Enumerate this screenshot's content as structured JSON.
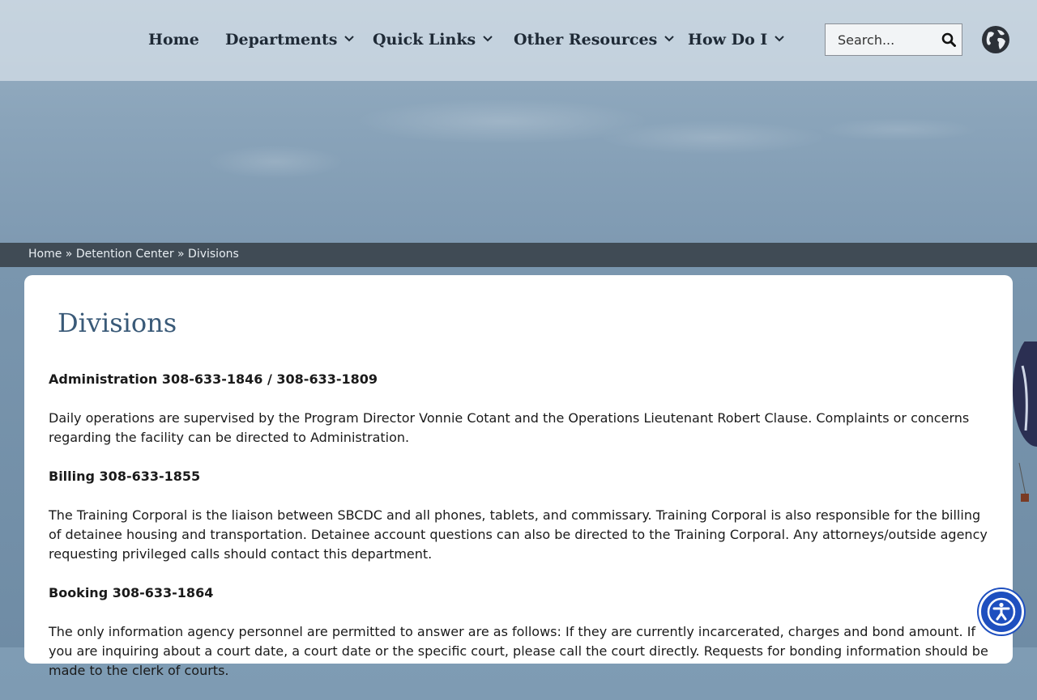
{
  "nav": {
    "items": [
      {
        "label": "Home",
        "has_dropdown": false
      },
      {
        "label": "Departments",
        "has_dropdown": true
      },
      {
        "label": "Quick Links",
        "has_dropdown": true
      },
      {
        "label": "Other Resources",
        "has_dropdown": true
      },
      {
        "label": "How Do I",
        "has_dropdown": true
      }
    ]
  },
  "search": {
    "placeholder": "Search..."
  },
  "breadcrumb": {
    "home": "Home",
    "separator": " » ",
    "parent": "Detention Center",
    "current": "Divisions"
  },
  "page": {
    "title": "Divisions",
    "sections": [
      {
        "heading": "Administration 308-633-1846 / 308-633-1809",
        "body": "Daily operations are supervised by the Program Director Vonnie Cotant and the Operations Lieutenant Robert Clause. Complaints or concerns regarding the facility can be directed to Administration."
      },
      {
        "heading": "Billing 308-633-1855",
        "body": "The Training Corporal is the liaison between SBCDC and all phones, tablets, and commissary. Training Corporal is also responsible for the billing of detainee housing and transportation. Detainee account questions can also be directed to the Training Corporal. Any attorneys/outside agency requesting privileged calls should contact this department."
      },
      {
        "heading": "Booking 308-633-1864",
        "body": "The only information agency personnel are permitted to answer are as follows: If they are currently incarcerated, charges and bond amount. If you are inquiring about a court date, a court date or the specific court, please call the court directly. Requests for bonding information should be made to the clerk of courts."
      }
    ]
  },
  "colors": {
    "header_bg": "#d7e1e9",
    "breadcrumb_bg": "#404b55",
    "title": "#3a5a78",
    "accessibility_button": "#1e4fbf"
  },
  "icons": {
    "chevron": "chevron-down-icon",
    "search": "search-icon",
    "globe": "globe-icon",
    "accessibility": "accessibility-icon"
  }
}
